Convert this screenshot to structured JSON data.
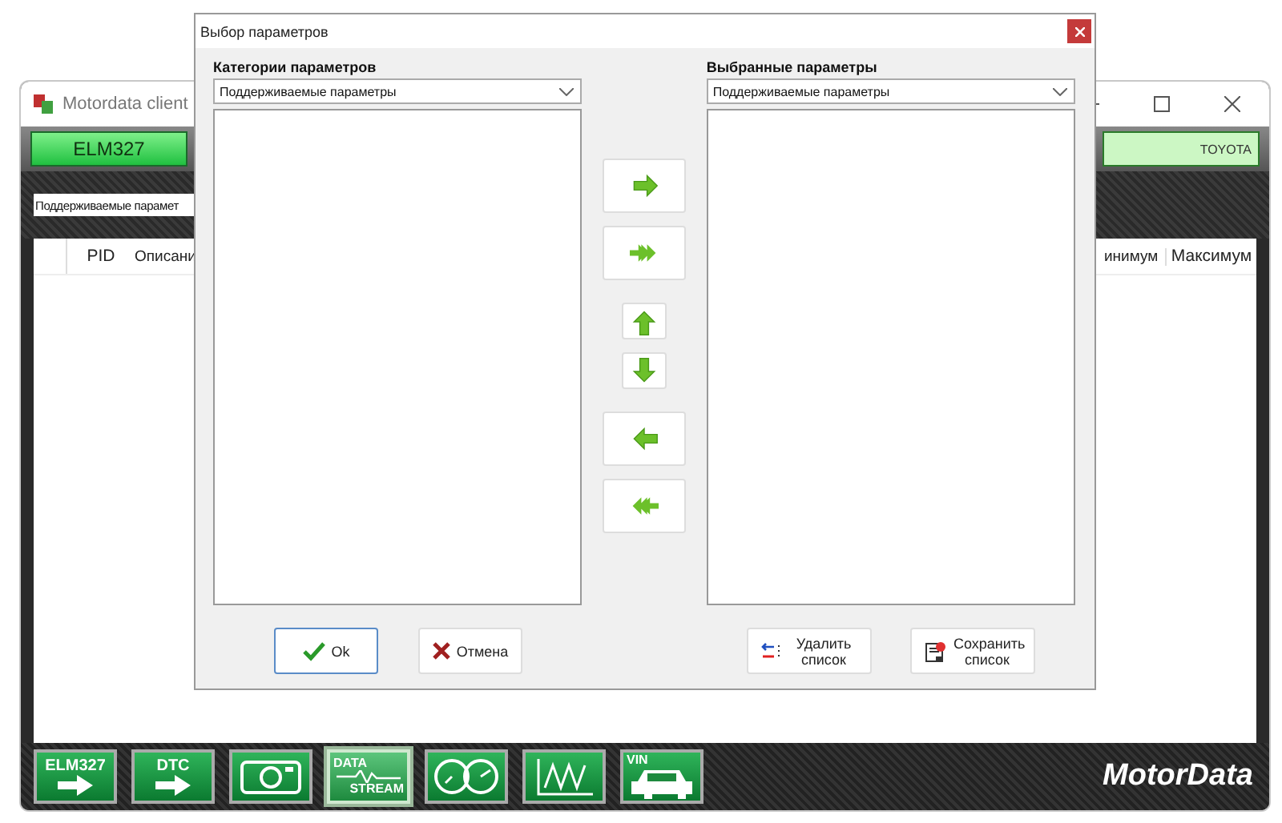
{
  "main_window": {
    "title": "Motordata client",
    "connection_button": "ELM327",
    "vehicle": "TOYOTA",
    "filter": "Поддерживаемые парамет",
    "columns": [
      "PID",
      "Описани",
      "инимум",
      "Максимум"
    ],
    "toolbar": [
      {
        "kind": "elm",
        "label": "ELM327",
        "selected": false
      },
      {
        "kind": "dtc",
        "label": "DTC",
        "selected": false
      },
      {
        "kind": "camera",
        "selected": false
      },
      {
        "kind": "stream",
        "label": "DATA",
        "sublabel": "STREAM",
        "selected": true
      },
      {
        "kind": "gauges",
        "selected": false
      },
      {
        "kind": "graph",
        "selected": false
      },
      {
        "kind": "vin",
        "label": "VIN",
        "selected": false
      }
    ],
    "logo": "MotorData"
  },
  "dialog": {
    "title": "Выбор параметров",
    "left": {
      "heading": "Категории параметров",
      "dropdown": "Поддерживаемые параметры"
    },
    "right": {
      "heading": "Выбранные параметры",
      "dropdown": "Поддерживаемые параметры"
    },
    "transfer_buttons": [
      {
        "kind": "right"
      },
      {
        "kind": "all-right"
      },
      {
        "kind": "up"
      },
      {
        "kind": "down"
      },
      {
        "kind": "left"
      },
      {
        "kind": "all-left"
      }
    ],
    "buttons": [
      {
        "kind": "ok",
        "label": "Ok",
        "focused": true
      },
      {
        "kind": "cancel",
        "label": "Отмена",
        "focused": false
      },
      {
        "kind": "delete",
        "label": "Удалить список",
        "focused": false
      },
      {
        "kind": "save",
        "label": "Сохранить список",
        "focused": false
      }
    ]
  }
}
